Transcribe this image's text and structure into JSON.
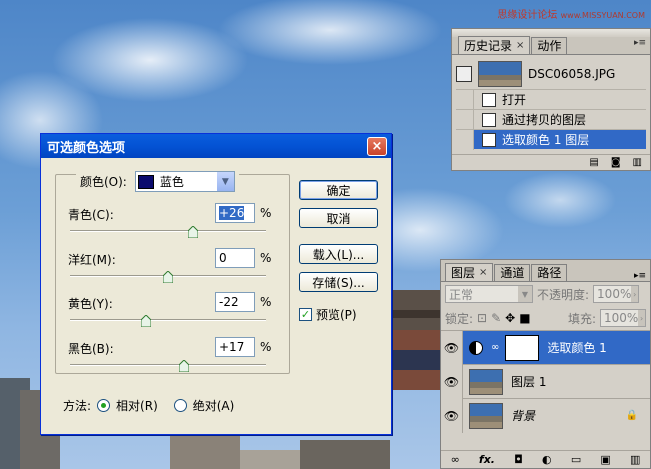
{
  "watermark": {
    "text": "思缘设计论坛",
    "site": "www.MISSYUAN.COM"
  },
  "history_panel": {
    "tabs": [
      {
        "label": "历史记录",
        "close": "×"
      },
      {
        "label": "动作"
      }
    ],
    "menu_icon": "panel-menu-icon",
    "snapshot": {
      "name": "DSC06058.JPG"
    },
    "items": [
      {
        "label": "打开",
        "selected": false
      },
      {
        "label": "通过拷贝的图层",
        "selected": false
      },
      {
        "label": "选取颜色 1 图层",
        "selected": true
      }
    ]
  },
  "layers_panel": {
    "tabs": [
      {
        "label": "图层",
        "close": "×"
      },
      {
        "label": "通道"
      },
      {
        "label": "路径"
      }
    ],
    "blend_mode": "正常",
    "opacity_label": "不透明度:",
    "opacity_value": "100%",
    "lock_label": "锁定:",
    "fill_label": "填充:",
    "fill_value": "100%",
    "layers": [
      {
        "name": "选取颜色 1",
        "selected": true
      },
      {
        "name": "图层 1",
        "selected": false
      },
      {
        "name": "背景",
        "selected": false,
        "locked": true
      }
    ],
    "footer_icons": [
      "link-icon",
      "fx-icon",
      "mask-icon",
      "adjustment-icon",
      "folder-icon",
      "new-layer-icon",
      "trash-icon"
    ],
    "fx_label": "fx."
  },
  "dialog": {
    "title": "可选颜色选项",
    "close": "×",
    "color_label": "颜色(O):",
    "color_value": "蓝色",
    "swatch_color": "#0b0b6e",
    "sliders": [
      {
        "label": "青色(C):",
        "value": "+26",
        "percent": 63,
        "unit": "%",
        "highlighted": true
      },
      {
        "label": "洋红(M):",
        "value": "0",
        "percent": 50,
        "unit": "%",
        "highlighted": false
      },
      {
        "label": "黄色(Y):",
        "value": "-22",
        "percent": 39,
        "unit": "%",
        "highlighted": false
      },
      {
        "label": "黑色(B):",
        "value": "+17",
        "percent": 58,
        "unit": "%",
        "highlighted": false
      }
    ],
    "buttons": {
      "ok": "确定",
      "cancel": "取消",
      "load": "载入(L)...",
      "save": "存储(S)..."
    },
    "preview_label": "预览(P)",
    "preview_checked": true,
    "method_label": "方法:",
    "method_relative": "相对(R)",
    "method_absolute": "绝对(A)",
    "method_selected": "relative"
  }
}
